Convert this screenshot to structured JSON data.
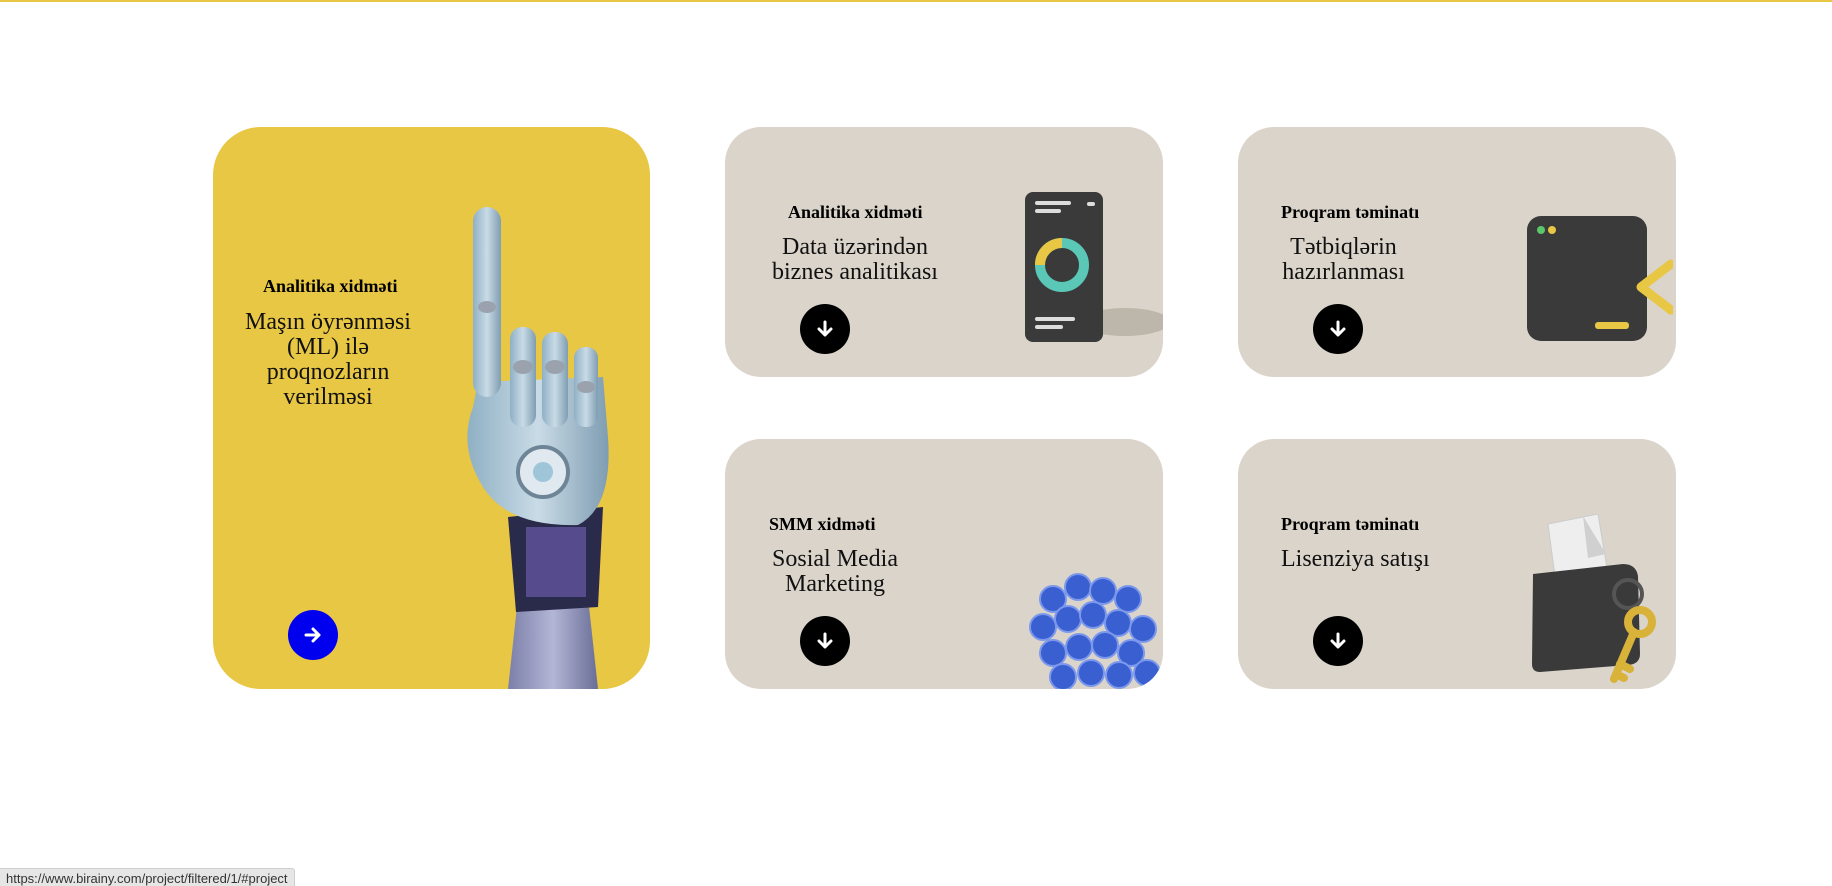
{
  "colors": {
    "accent_yellow": "#e8c744",
    "card_beige": "#dad4ca",
    "button_black": "#000000",
    "button_blue": "#0000ee"
  },
  "cards": [
    {
      "eyebrow": "Analitika xidməti",
      "title": "Maşın öyrənməsi (ML) ilə proqnozların verilməsi",
      "button_icon": "arrow-right-icon",
      "illustration": "robot-hand-icon"
    },
    {
      "eyebrow": "Analitika xidməti",
      "title": "Data üzərindən biznes analitikası",
      "button_icon": "arrow-down-icon",
      "illustration": "phone-donut-chart-icon"
    },
    {
      "eyebrow": "Proqram təminatı",
      "title": "Tətbiqlərin hazırlanması",
      "button_icon": "arrow-down-icon",
      "illustration": "code-window-icon"
    },
    {
      "eyebrow": "SMM xidməti",
      "title": "Sosial Media Marketing",
      "button_icon": "arrow-down-icon",
      "illustration": "like-bubbles-icon"
    },
    {
      "eyebrow": "Proqram təminatı",
      "title": "Lisenziya satışı",
      "button_icon": "arrow-down-icon",
      "illustration": "folder-key-icon"
    }
  ],
  "status_bar": {
    "url": "https://www.birainy.com/project/filtered/1/#project"
  }
}
